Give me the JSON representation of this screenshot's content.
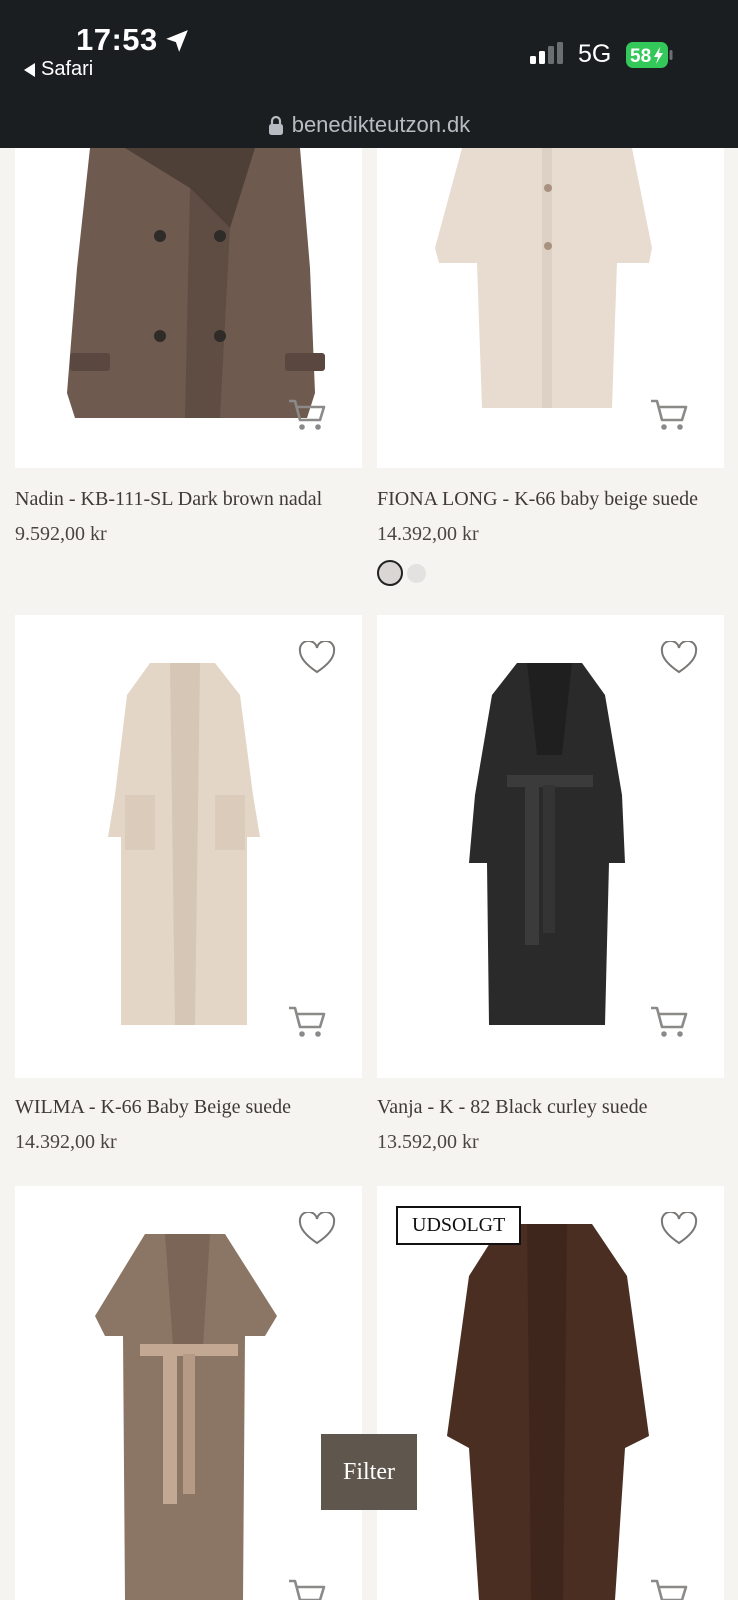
{
  "status_bar": {
    "time": "17:53",
    "back_app": "Safari",
    "network": "5G",
    "battery": "58"
  },
  "browser": {
    "url": "benedikteutzon.dk"
  },
  "products": [
    {
      "title": "Nadin - KB-111-SL Dark brown nadal",
      "price": "9.592,00 kr"
    },
    {
      "title": "FIONA LONG - K-66 baby beige suede",
      "price": "14.392,00 kr"
    },
    {
      "title": "WILMA - K-66 Baby Beige suede",
      "price": "14.392,00 kr"
    },
    {
      "title": "Vanja - K - 82 Black curley suede",
      "price": "13.592,00 kr"
    }
  ],
  "badge": "UDSOLGT",
  "filter_label": "Filter",
  "colors": {
    "statusbar": "#1b1e21",
    "filter": "#5f574d",
    "battery": "#34c759"
  }
}
